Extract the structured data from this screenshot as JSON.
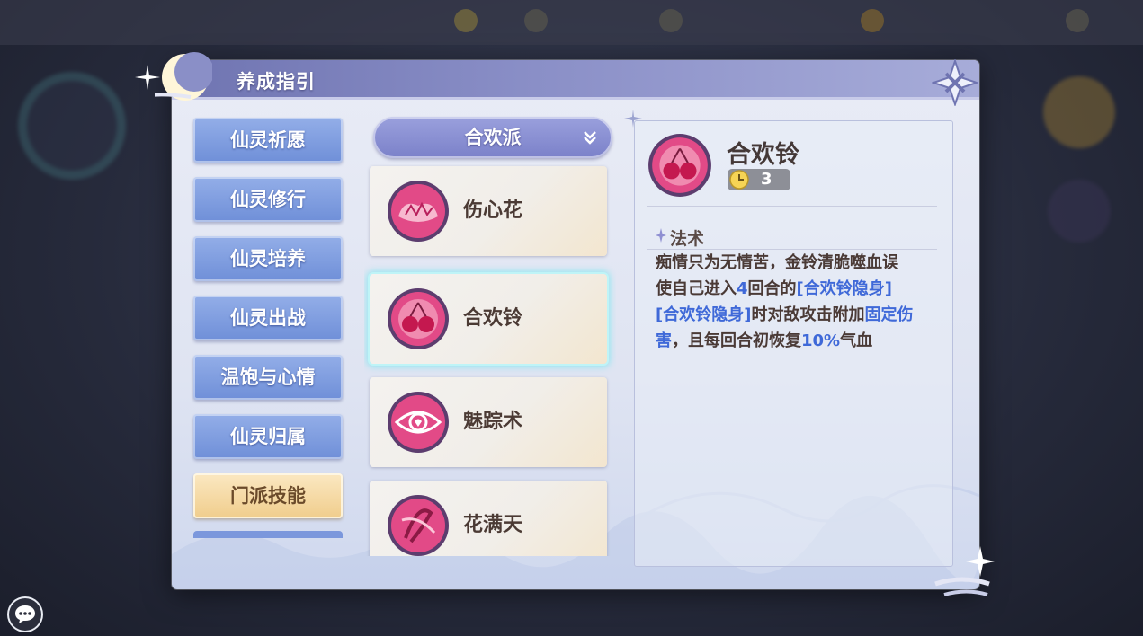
{
  "panel": {
    "title": "养成指引"
  },
  "nav": {
    "items": [
      {
        "label": "仙灵祈愿",
        "active": false
      },
      {
        "label": "仙灵修行",
        "active": false
      },
      {
        "label": "仙灵培养",
        "active": false
      },
      {
        "label": "仙灵出战",
        "active": false
      },
      {
        "label": "温饱与心情",
        "active": false
      },
      {
        "label": "仙灵归属",
        "active": false
      },
      {
        "label": "门派技能",
        "active": true
      }
    ]
  },
  "filter": {
    "selected": "合欢派"
  },
  "skills": [
    {
      "name": "伤心花",
      "icon": "petal-flower-icon",
      "selected": false
    },
    {
      "name": "合欢铃",
      "icon": "cherry-bell-icon",
      "selected": true
    },
    {
      "name": "魅踪术",
      "icon": "charm-eye-icon",
      "selected": false
    },
    {
      "name": "花满天",
      "icon": "flower-swirl-icon",
      "selected": false
    }
  ],
  "detail": {
    "name": "合欢铃",
    "cost": "3",
    "cost_icon": "clock-icon",
    "type_label": "法术",
    "desc_1": "痴情只为无情苦，金铃清脆噬血误",
    "desc_2a": "使自己进入",
    "desc_2b": "4",
    "desc_2c": "回合的",
    "desc_2d": "[合欢铃隐身]",
    "desc_3a": "[合欢铃隐身]",
    "desc_3b": "时对敌攻击附加",
    "desc_3c": "固定伤",
    "desc_4a": "害",
    "desc_4b": "，且每回合初恢复",
    "desc_4c": "10%",
    "desc_4d": "气血"
  },
  "colors": {
    "accent_blue": "#3f69d8",
    "nav_blue": "#6f8fd8",
    "nav_active": "#f0cd8c",
    "header": "#7b81c9",
    "selected_glow": "#bff4f7"
  }
}
